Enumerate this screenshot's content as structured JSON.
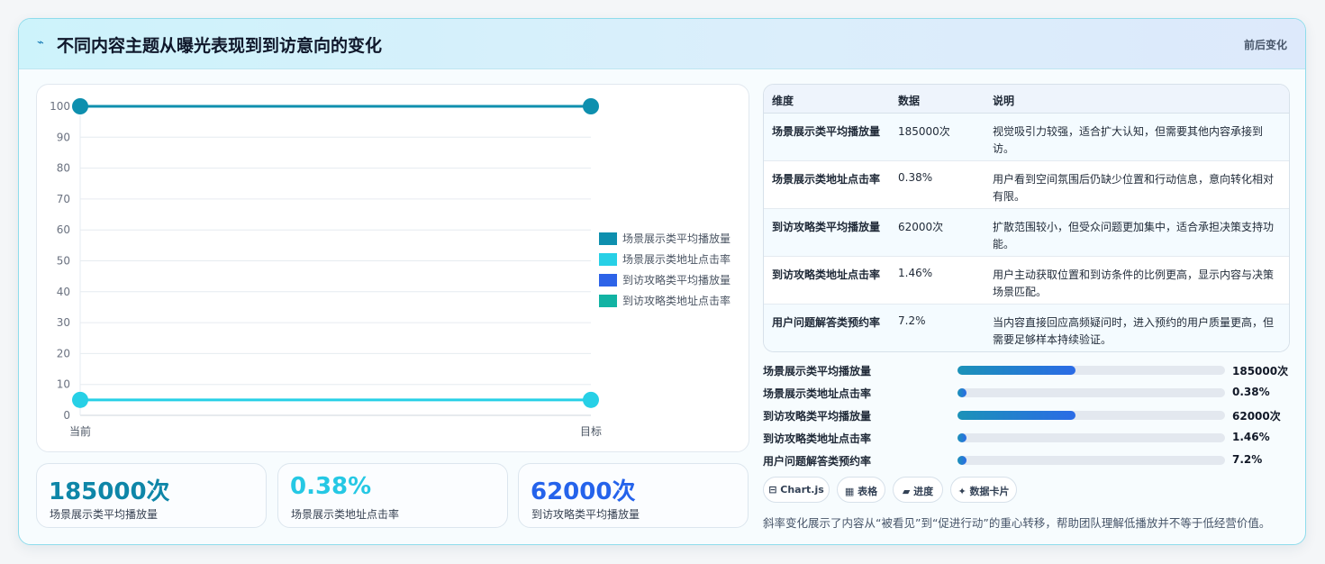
{
  "header": {
    "icon": "sparkle-icon",
    "title": "不同内容主题从曝光表现到到访意向的变化",
    "right_label": "前后变化"
  },
  "chart_data": {
    "type": "line",
    "x": [
      "当前",
      "目标"
    ],
    "ylim": [
      0,
      100
    ],
    "yticks": [
      0,
      10,
      20,
      30,
      40,
      50,
      60,
      70,
      80,
      90,
      100
    ],
    "legend_position": "right",
    "series": [
      {
        "name": "场景展示类平均播放量",
        "values": [
          100,
          100
        ],
        "color": "#0e8fae"
      },
      {
        "name": "场景展示类地址点击率",
        "values": [
          5,
          5
        ],
        "color": "#27d0e6"
      },
      {
        "name": "到访攻略类平均播放量",
        "values": [],
        "color": "#2d63e8"
      },
      {
        "name": "到访攻略类地址点击率",
        "values": [],
        "color": "#12b3a3"
      }
    ],
    "grid": true
  },
  "stats": [
    {
      "value": "185000次",
      "label": "场景展示类平均播放量",
      "color": "#0e86a8"
    },
    {
      "value": "0.38%",
      "label": "场景展示类地址点击率",
      "color": "#25c8e4"
    },
    {
      "value": "62000次",
      "label": "到访攻略类平均播放量",
      "color": "#2563eb"
    }
  ],
  "table": {
    "headers": [
      "维度",
      "数据",
      "说明"
    ],
    "rows": [
      [
        "场景展示类平均播放量",
        "185000次",
        "视觉吸引力较强，适合扩大认知，但需要其他内容承接到访。"
      ],
      [
        "场景展示类地址点击率",
        "0.38%",
        "用户看到空间氛围后仍缺少位置和行动信息，意向转化相对有限。"
      ],
      [
        "到访攻略类平均播放量",
        "62000次",
        "扩散范围较小，但受众问题更加集中，适合承担决策支持功能。"
      ],
      [
        "到访攻略类地址点击率",
        "1.46%",
        "用户主动获取位置和到访条件的比例更高，显示内容与决策场景匹配。"
      ],
      [
        "用户问题解答类预约率",
        "7.2%",
        "当内容直接回应高频疑问时，进入预约的用户质量更高，但需要足够样本持续验证。"
      ]
    ]
  },
  "bars": [
    {
      "label": "场景展示类平均播放量",
      "value": "185000次",
      "fraction": 0.44
    },
    {
      "label": "场景展示类地址点击率",
      "value": "0.38%",
      "fraction": 0.035
    },
    {
      "label": "到访攻略类平均播放量",
      "value": "62000次",
      "fraction": 0.44
    },
    {
      "label": "到访攻略类地址点击率",
      "value": "1.46%",
      "fraction": 0.035
    },
    {
      "label": "用户问题解答类预约率",
      "value": "7.2%",
      "fraction": 0.035
    }
  ],
  "tags": [
    "⊟ Chart.js",
    "▦ 表格",
    "▰ 进度",
    "✦ 数据卡片"
  ],
  "footnote": "斜率变化展示了内容从“被看见”到“促进行动”的重心转移，帮助团队理解低播放并不等于低经营价值。"
}
